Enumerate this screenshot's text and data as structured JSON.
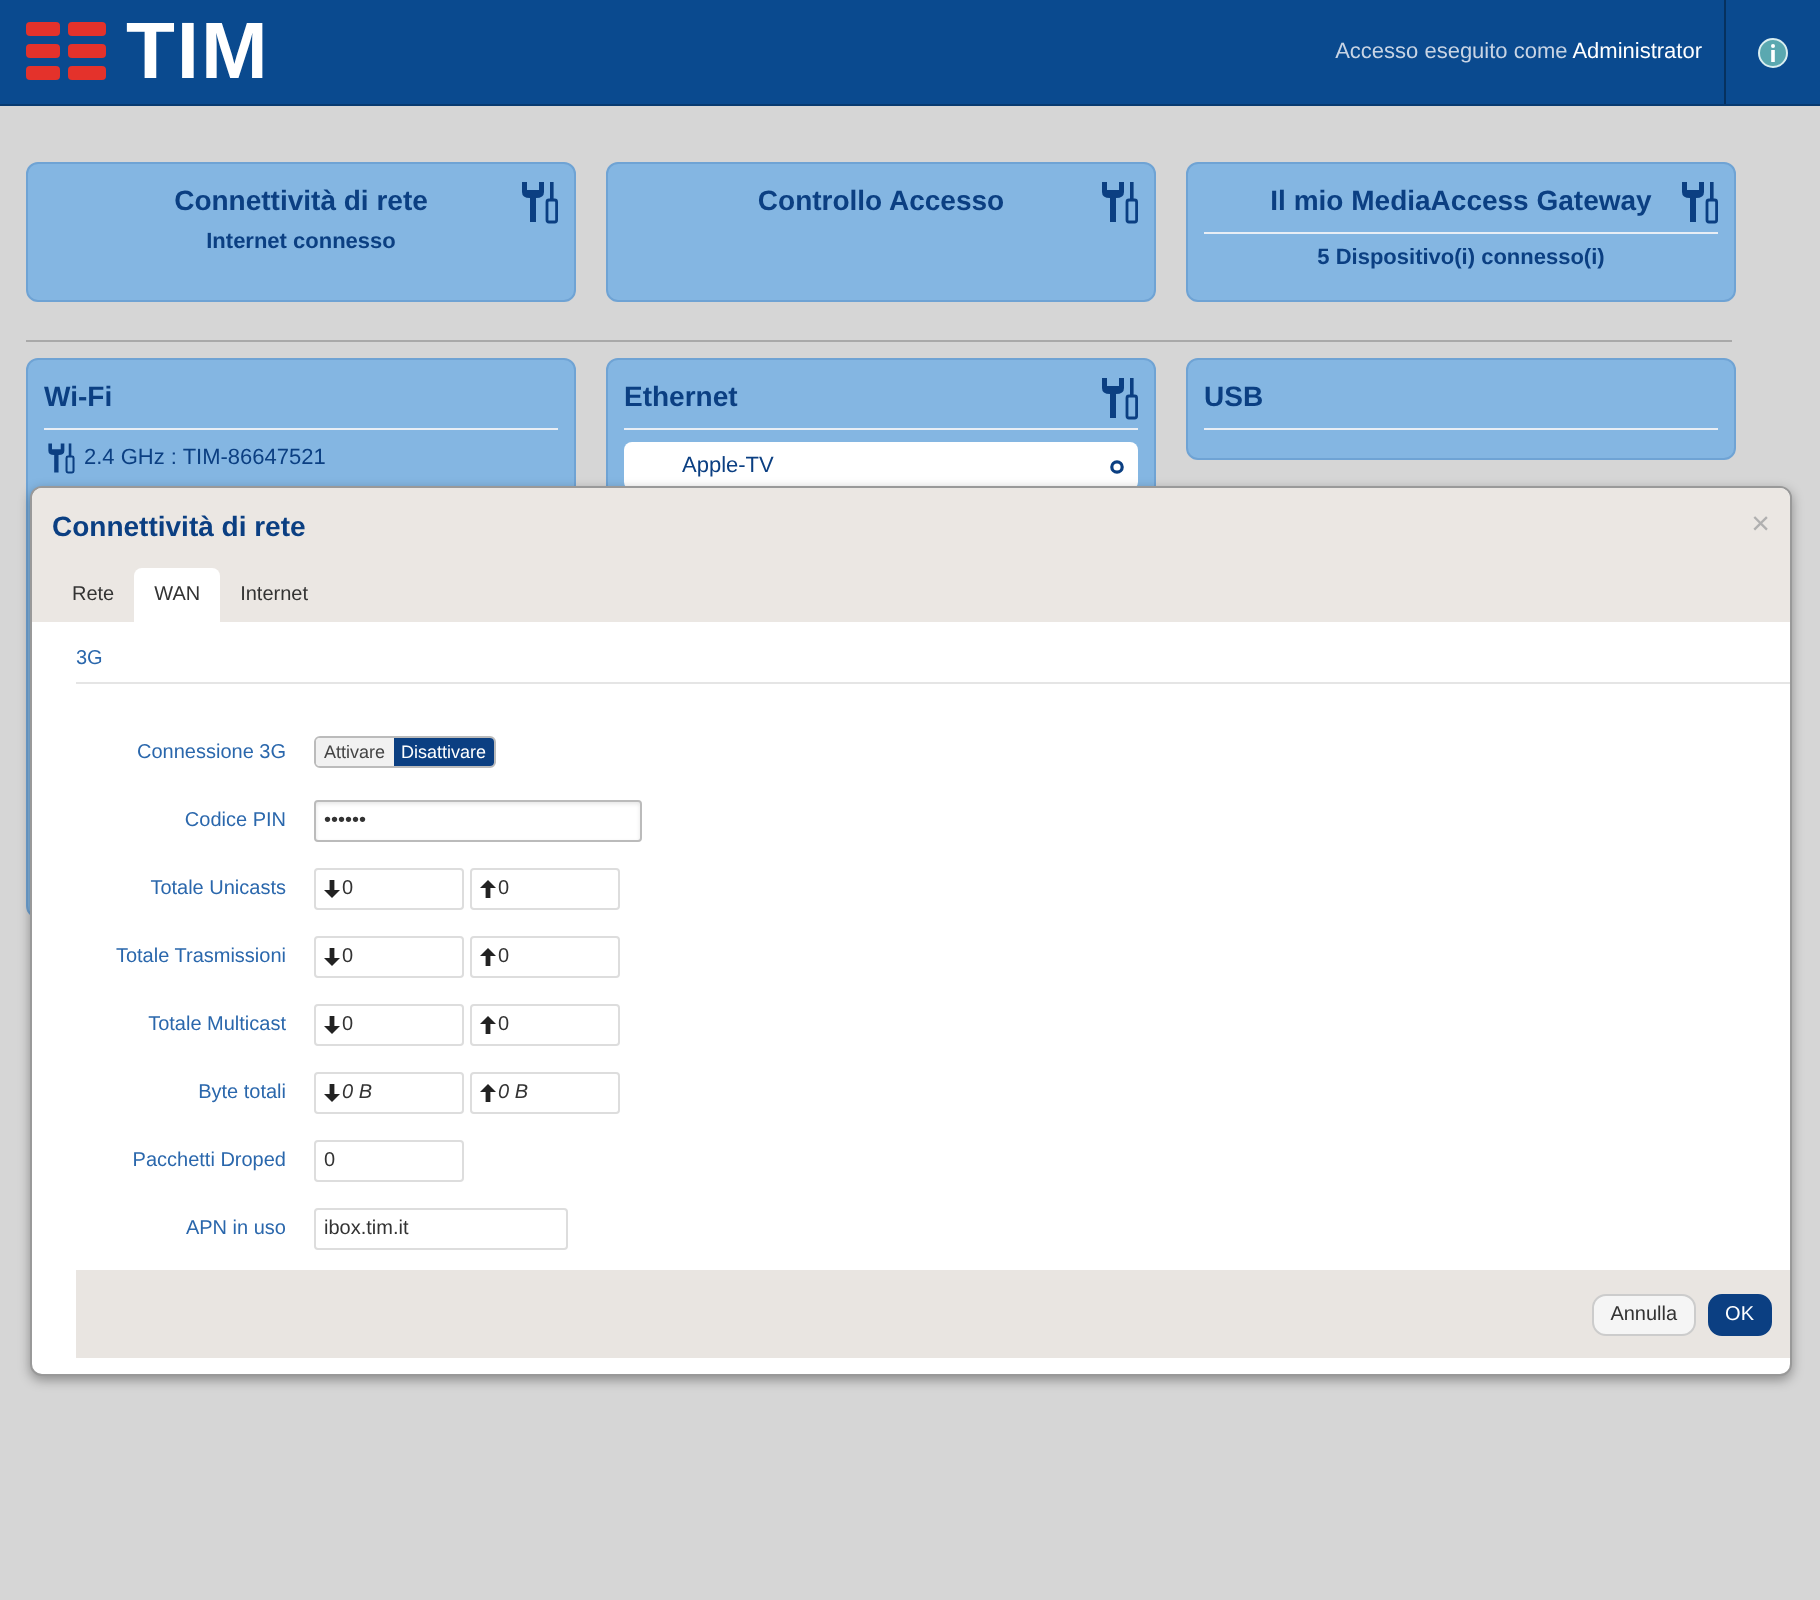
{
  "header": {
    "brand": "TIM",
    "login_prefix": "Accesso eseguito come",
    "login_user": "Administrator"
  },
  "cards_top": [
    {
      "title": "Connettività di rete",
      "subtitle": "Internet connesso",
      "tools": true,
      "divider": false
    },
    {
      "title": "Controllo Accesso",
      "tools": true,
      "divider": false
    },
    {
      "title": "Il mio MediaAccess Gateway",
      "subtitle": "5 Dispositivo(i) connesso(i)",
      "tools": true,
      "divider": true
    }
  ],
  "cards_bottom": [
    {
      "title": "Wi-Fi",
      "kind": "wifi",
      "line": "2.4 GHz : TIM-86647521",
      "tools": false
    },
    {
      "title": "Ethernet",
      "kind": "ethernet",
      "line": "Apple-TV",
      "tools": true
    },
    {
      "title": "USB",
      "kind": "plain",
      "tools": false
    }
  ],
  "modal": {
    "title": "Connettività di rete",
    "close": "×",
    "tabs": [
      {
        "label": "Rete",
        "selected": false
      },
      {
        "label": "WAN",
        "selected": true
      },
      {
        "label": "Internet",
        "selected": false
      }
    ],
    "section": "3G",
    "rows": [
      {
        "label": "Connessione 3G",
        "kind": "toggle",
        "options": [
          {
            "label": "Attivare",
            "selected": false
          },
          {
            "label": "Disattivare",
            "selected": true
          }
        ]
      },
      {
        "label": "Codice PIN",
        "kind": "pin",
        "value": "••••••"
      },
      {
        "label": "Totale Unicasts",
        "kind": "pair",
        "italic": false,
        "down": "0",
        "up": "0"
      },
      {
        "label": "Totale Trasmissioni",
        "kind": "pair",
        "italic": false,
        "down": "0",
        "up": "0"
      },
      {
        "label": "Totale Multicast",
        "kind": "pair",
        "italic": false,
        "down": "0",
        "up": "0"
      },
      {
        "label": "Byte totali",
        "kind": "pair",
        "italic": true,
        "down": "0 B",
        "up": "0 B"
      },
      {
        "label": "Pacchetti Droped",
        "kind": "short",
        "value": "0"
      },
      {
        "label": "APN in uso",
        "kind": "long",
        "value": "ibox.tim.it"
      }
    ],
    "buttons": [
      {
        "label": "Annulla",
        "primary": false
      },
      {
        "label": "OK",
        "primary": true
      }
    ]
  }
}
